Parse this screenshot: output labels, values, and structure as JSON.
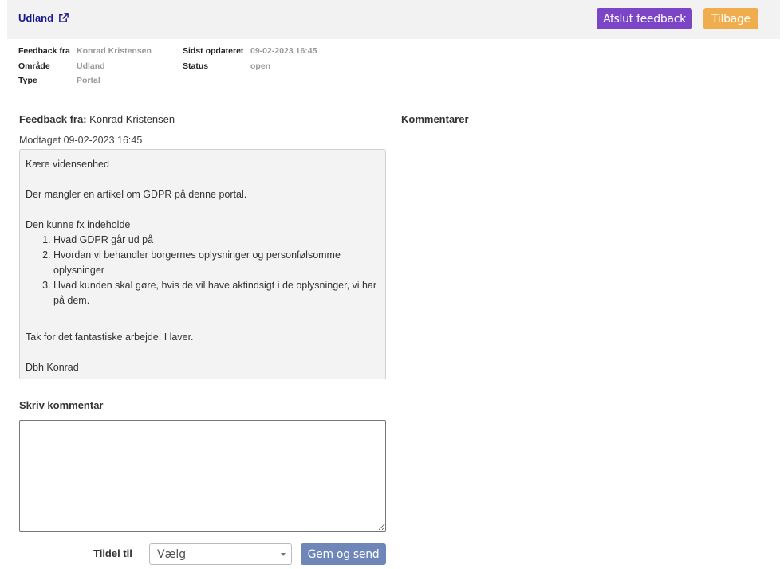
{
  "header": {
    "title": "Udland",
    "title_icon": "external-link-icon",
    "finish_button": "Afslut feedback",
    "back_button": "Tilbage"
  },
  "meta": {
    "feedback_from_label": "Feedback fra",
    "feedback_from_value": "Konrad Kristensen",
    "area_label": "Område",
    "area_value": "Udland",
    "type_label": "Type",
    "type_value": "Portal",
    "updated_label": "Sidst opdateret",
    "updated_value": "09-02-2023 16:45",
    "status_label": "Status",
    "status_value": "open"
  },
  "feedback": {
    "heading_label": "Feedback fra:",
    "heading_name": "Konrad Kristensen",
    "received": "Modtaget 09-02-2023 16:45",
    "greeting": "Kære vidensenhed",
    "line1": "Der mangler en artikel om GDPR på denne portal.",
    "list_intro": "Den kunne fx indeholde",
    "list": [
      "Hvad GDPR går ud på",
      "Hvordan vi behandler borgernes oplysninger og personfølsomme oplysninger",
      "Hvad kunden skal gøre, hvis de vil have aktindsigt i de oplysninger, vi har på dem."
    ],
    "thanks": "Tak for det fantastiske arbejde, I laver.",
    "signature": "Dbh Konrad"
  },
  "comments": {
    "title": "Kommentarer"
  },
  "compose": {
    "label": "Skriv kommentar",
    "text": "",
    "assign_label": "Tildel til",
    "assign_selected": "Vælg",
    "send_button": "Gem og send"
  },
  "colors": {
    "finish": "#7c45c6",
    "back": "#f0ad4e",
    "send": "#6f86b8",
    "title_link": "#1a1a8c"
  }
}
